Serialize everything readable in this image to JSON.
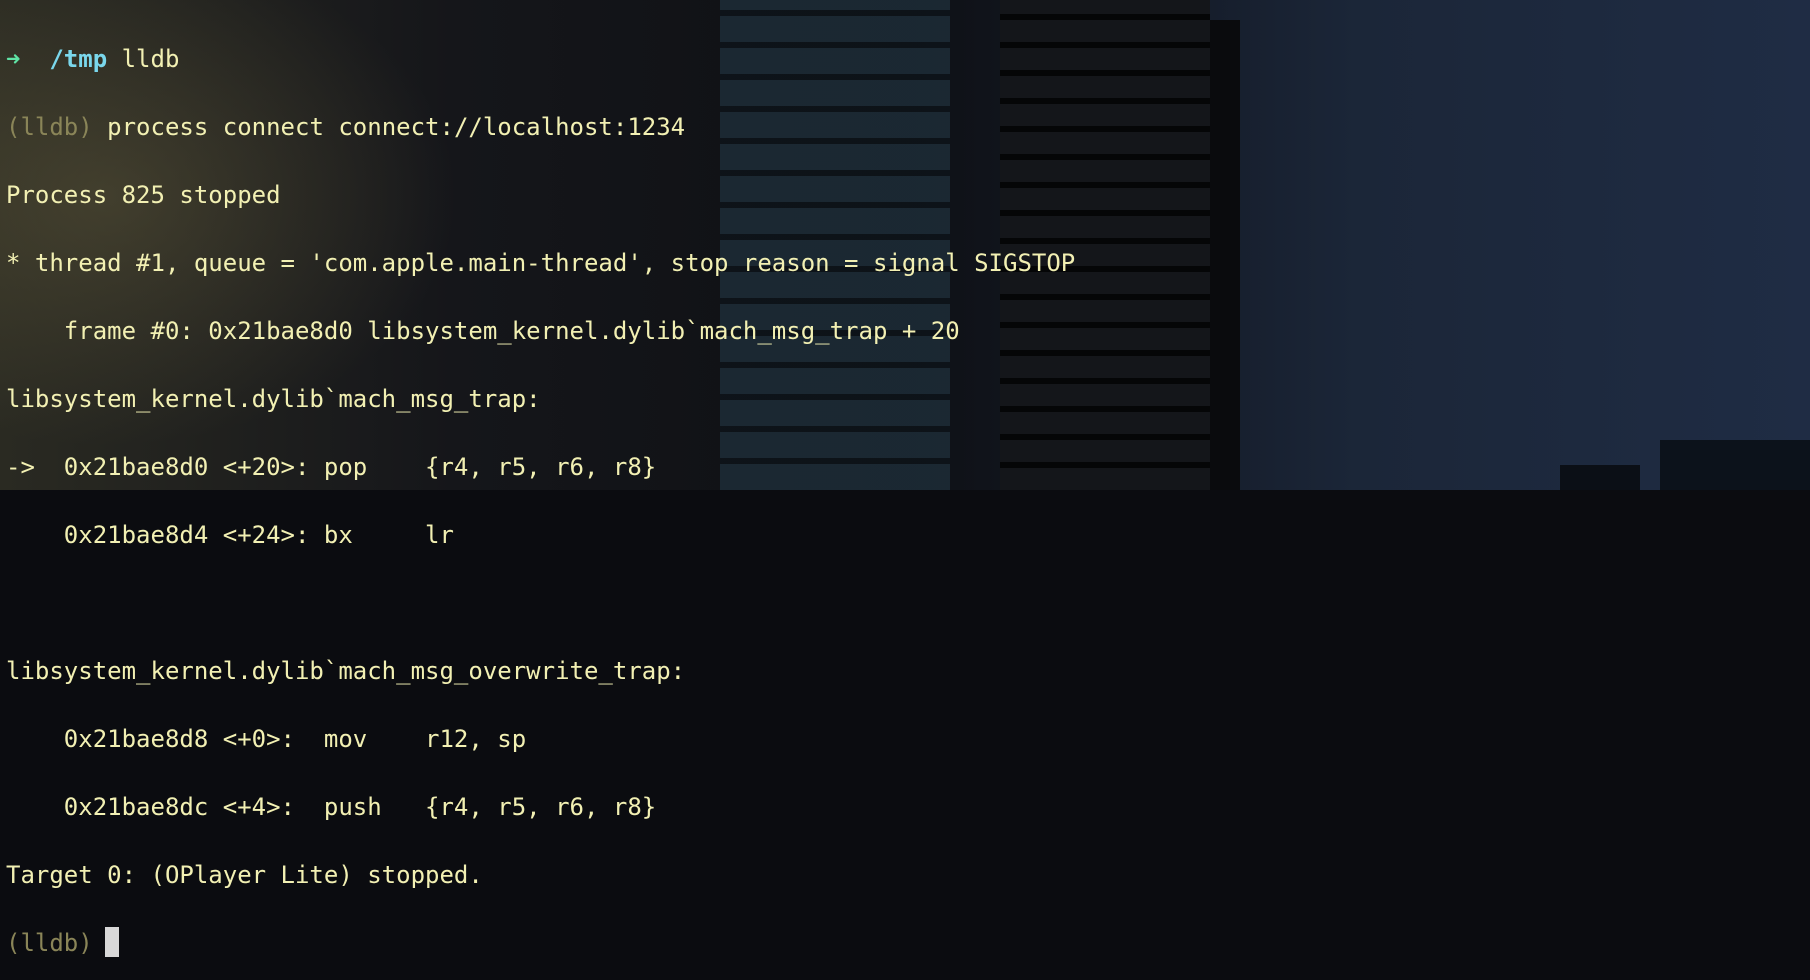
{
  "terminal": {
    "shell_prompt": {
      "arrow": "➜",
      "cwd": "/tmp",
      "command": "lldb"
    },
    "lldb_prompt": "(lldb)",
    "command_connect": "process connect connect://localhost:1234",
    "lines": [
      "Process 825 stopped",
      "* thread #1, queue = 'com.apple.main-thread', stop reason = signal SIGSTOP",
      "    frame #0: 0x21bae8d0 libsystem_kernel.dylib`mach_msg_trap + 20",
      "libsystem_kernel.dylib`mach_msg_trap:",
      "->  0x21bae8d0 <+20>: pop    {r4, r5, r6, r8}",
      "    0x21bae8d4 <+24>: bx     lr",
      "",
      "libsystem_kernel.dylib`mach_msg_overwrite_trap:",
      "    0x21bae8d8 <+0>:  mov    r12, sp",
      "    0x21bae8dc <+4>:  push   {r4, r5, r6, r8}",
      "Target 0: (OPlayer Lite) stopped."
    ],
    "final_prompt": "(lldb)"
  },
  "colors": {
    "text": "#e8e6b2",
    "prompt_arrow": "#5fe3a5",
    "cwd": "#7ad7ec",
    "lldb_prompt": "#8a8558",
    "cursor": "#d8d8d8",
    "sky": "#1d2a40"
  }
}
